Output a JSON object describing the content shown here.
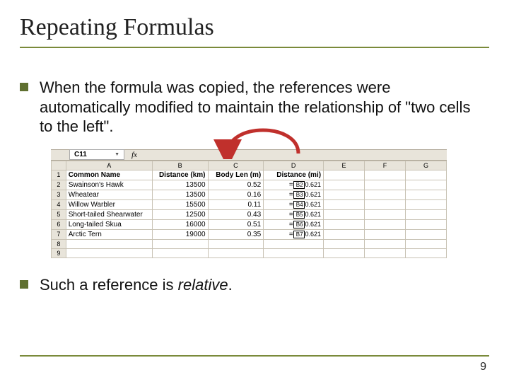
{
  "title": "Repeating Formulas",
  "bullet1": "When the formula was copied, the references were automatically modified to maintain the relationship of \"two cells to the left\".",
  "bullet2_pre": "Such a reference is ",
  "bullet2_em": "relative",
  "bullet2_post": ".",
  "pagenum": "9",
  "sheet": {
    "namebox": "C11",
    "fx": "fx",
    "cols": [
      "A",
      "B",
      "C",
      "D",
      "E",
      "F",
      "G"
    ],
    "headers": {
      "A": "Common Name",
      "B": "Distance (km)",
      "C": "Body Len (m)",
      "D": "Distance (mi)"
    },
    "rows": [
      {
        "n": "2",
        "A": "Swainson's Hawk",
        "B": "13500",
        "C": "0.52",
        "ref": "B2",
        "after": "0.621"
      },
      {
        "n": "3",
        "A": "Wheatear",
        "B": "13500",
        "C": "0.16",
        "ref": "B3",
        "after": "0.621"
      },
      {
        "n": "4",
        "A": "Willow Warbler",
        "B": "15500",
        "C": "0.11",
        "ref": "B4",
        "after": "0.621"
      },
      {
        "n": "5",
        "A": "Short-tailed Shearwater",
        "B": "12500",
        "C": "0.43",
        "ref": "B5",
        "after": "0.621"
      },
      {
        "n": "6",
        "A": "Long-tailed Skua",
        "B": "16000",
        "C": "0.51",
        "ref": "B6",
        "after": "0.621"
      },
      {
        "n": "7",
        "A": "Arctic Tern",
        "B": "19000",
        "C": "0.35",
        "ref": "B7",
        "after": "0.621"
      }
    ],
    "blank_rows": [
      "8",
      "9"
    ]
  }
}
